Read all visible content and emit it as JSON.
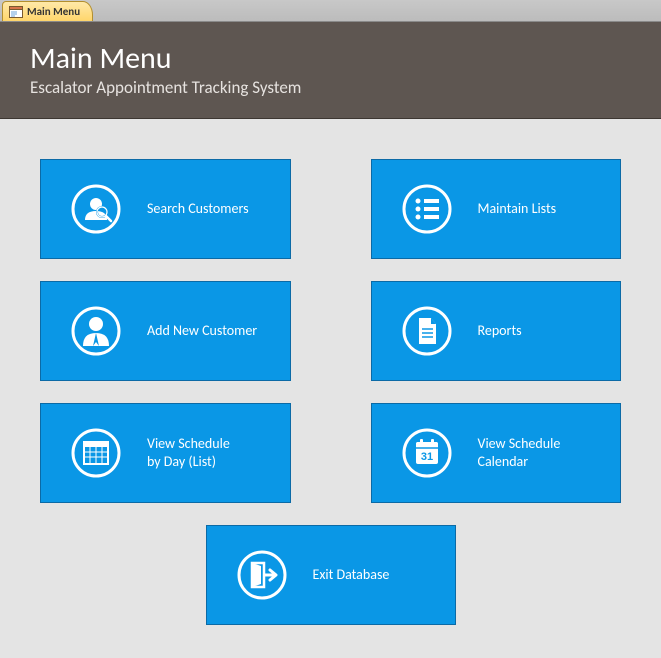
{
  "tab": {
    "label": "Main Menu"
  },
  "header": {
    "title": "Main Menu",
    "subtitle": "Escalator Appointment Tracking System"
  },
  "tiles": {
    "search_customers": "Search Customers",
    "maintain_lists": "Maintain Lists",
    "add_new_customer": "Add New Customer",
    "reports": "Reports",
    "view_schedule_list": "View Schedule\nby Day (List)",
    "view_schedule_calendar": "View Schedule\nCalendar",
    "exit_database": "Exit Database"
  }
}
